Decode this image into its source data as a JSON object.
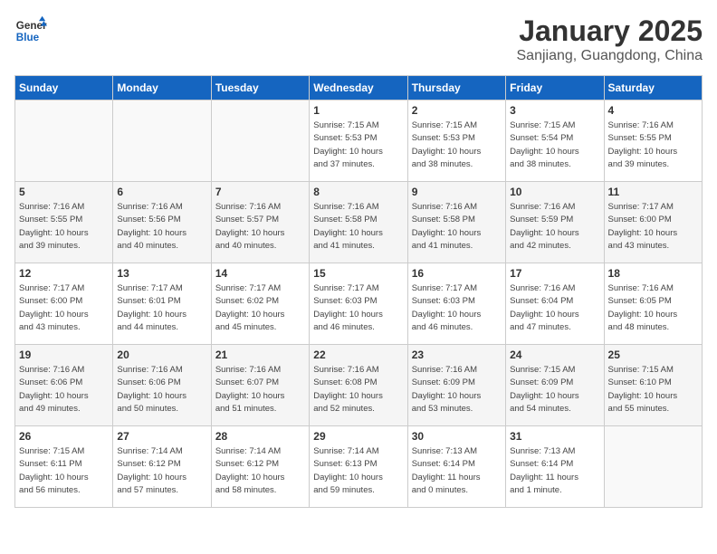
{
  "logo": {
    "line1": "General",
    "line2": "Blue"
  },
  "title": "January 2025",
  "subtitle": "Sanjiang, Guangdong, China",
  "days_of_week": [
    "Sunday",
    "Monday",
    "Tuesday",
    "Wednesday",
    "Thursday",
    "Friday",
    "Saturday"
  ],
  "weeks": [
    [
      {
        "day": "",
        "info": ""
      },
      {
        "day": "",
        "info": ""
      },
      {
        "day": "",
        "info": ""
      },
      {
        "day": "1",
        "info": "Sunrise: 7:15 AM\nSunset: 5:53 PM\nDaylight: 10 hours\nand 37 minutes."
      },
      {
        "day": "2",
        "info": "Sunrise: 7:15 AM\nSunset: 5:53 PM\nDaylight: 10 hours\nand 38 minutes."
      },
      {
        "day": "3",
        "info": "Sunrise: 7:15 AM\nSunset: 5:54 PM\nDaylight: 10 hours\nand 38 minutes."
      },
      {
        "day": "4",
        "info": "Sunrise: 7:16 AM\nSunset: 5:55 PM\nDaylight: 10 hours\nand 39 minutes."
      }
    ],
    [
      {
        "day": "5",
        "info": "Sunrise: 7:16 AM\nSunset: 5:55 PM\nDaylight: 10 hours\nand 39 minutes."
      },
      {
        "day": "6",
        "info": "Sunrise: 7:16 AM\nSunset: 5:56 PM\nDaylight: 10 hours\nand 40 minutes."
      },
      {
        "day": "7",
        "info": "Sunrise: 7:16 AM\nSunset: 5:57 PM\nDaylight: 10 hours\nand 40 minutes."
      },
      {
        "day": "8",
        "info": "Sunrise: 7:16 AM\nSunset: 5:58 PM\nDaylight: 10 hours\nand 41 minutes."
      },
      {
        "day": "9",
        "info": "Sunrise: 7:16 AM\nSunset: 5:58 PM\nDaylight: 10 hours\nand 41 minutes."
      },
      {
        "day": "10",
        "info": "Sunrise: 7:16 AM\nSunset: 5:59 PM\nDaylight: 10 hours\nand 42 minutes."
      },
      {
        "day": "11",
        "info": "Sunrise: 7:17 AM\nSunset: 6:00 PM\nDaylight: 10 hours\nand 43 minutes."
      }
    ],
    [
      {
        "day": "12",
        "info": "Sunrise: 7:17 AM\nSunset: 6:00 PM\nDaylight: 10 hours\nand 43 minutes."
      },
      {
        "day": "13",
        "info": "Sunrise: 7:17 AM\nSunset: 6:01 PM\nDaylight: 10 hours\nand 44 minutes."
      },
      {
        "day": "14",
        "info": "Sunrise: 7:17 AM\nSunset: 6:02 PM\nDaylight: 10 hours\nand 45 minutes."
      },
      {
        "day": "15",
        "info": "Sunrise: 7:17 AM\nSunset: 6:03 PM\nDaylight: 10 hours\nand 46 minutes."
      },
      {
        "day": "16",
        "info": "Sunrise: 7:17 AM\nSunset: 6:03 PM\nDaylight: 10 hours\nand 46 minutes."
      },
      {
        "day": "17",
        "info": "Sunrise: 7:16 AM\nSunset: 6:04 PM\nDaylight: 10 hours\nand 47 minutes."
      },
      {
        "day": "18",
        "info": "Sunrise: 7:16 AM\nSunset: 6:05 PM\nDaylight: 10 hours\nand 48 minutes."
      }
    ],
    [
      {
        "day": "19",
        "info": "Sunrise: 7:16 AM\nSunset: 6:06 PM\nDaylight: 10 hours\nand 49 minutes."
      },
      {
        "day": "20",
        "info": "Sunrise: 7:16 AM\nSunset: 6:06 PM\nDaylight: 10 hours\nand 50 minutes."
      },
      {
        "day": "21",
        "info": "Sunrise: 7:16 AM\nSunset: 6:07 PM\nDaylight: 10 hours\nand 51 minutes."
      },
      {
        "day": "22",
        "info": "Sunrise: 7:16 AM\nSunset: 6:08 PM\nDaylight: 10 hours\nand 52 minutes."
      },
      {
        "day": "23",
        "info": "Sunrise: 7:16 AM\nSunset: 6:09 PM\nDaylight: 10 hours\nand 53 minutes."
      },
      {
        "day": "24",
        "info": "Sunrise: 7:15 AM\nSunset: 6:09 PM\nDaylight: 10 hours\nand 54 minutes."
      },
      {
        "day": "25",
        "info": "Sunrise: 7:15 AM\nSunset: 6:10 PM\nDaylight: 10 hours\nand 55 minutes."
      }
    ],
    [
      {
        "day": "26",
        "info": "Sunrise: 7:15 AM\nSunset: 6:11 PM\nDaylight: 10 hours\nand 56 minutes."
      },
      {
        "day": "27",
        "info": "Sunrise: 7:14 AM\nSunset: 6:12 PM\nDaylight: 10 hours\nand 57 minutes."
      },
      {
        "day": "28",
        "info": "Sunrise: 7:14 AM\nSunset: 6:12 PM\nDaylight: 10 hours\nand 58 minutes."
      },
      {
        "day": "29",
        "info": "Sunrise: 7:14 AM\nSunset: 6:13 PM\nDaylight: 10 hours\nand 59 minutes."
      },
      {
        "day": "30",
        "info": "Sunrise: 7:13 AM\nSunset: 6:14 PM\nDaylight: 11 hours\nand 0 minutes."
      },
      {
        "day": "31",
        "info": "Sunrise: 7:13 AM\nSunset: 6:14 PM\nDaylight: 11 hours\nand 1 minute."
      },
      {
        "day": "",
        "info": ""
      }
    ]
  ]
}
